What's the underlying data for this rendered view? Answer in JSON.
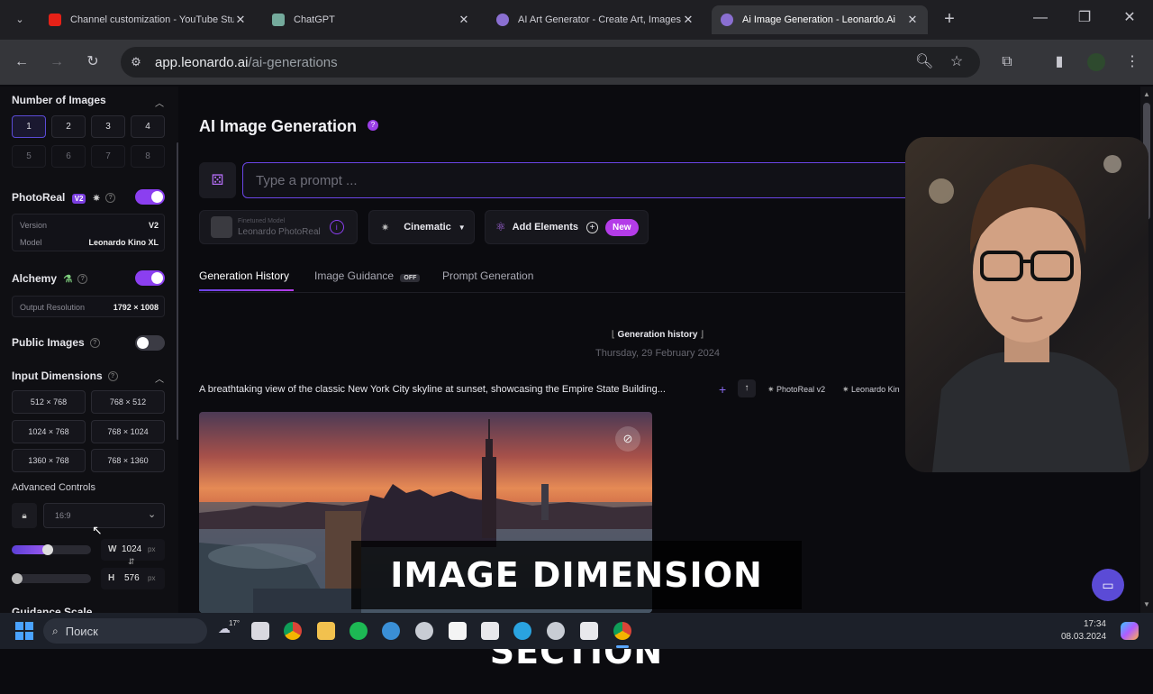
{
  "browser": {
    "tabs": [
      {
        "title": "Channel customization - YouTube Studi",
        "close": "✕"
      },
      {
        "title": "ChatGPT",
        "close": "✕"
      },
      {
        "title": "AI Art Generator - Create Art, Images &",
        "close": "✕"
      },
      {
        "title": "Ai Image Generation - Leonardo.Ai",
        "close": "✕"
      }
    ],
    "new_tab": "+",
    "url_host": "app.leonardo.ai",
    "url_path": "/ai-generations"
  },
  "sidebar": {
    "number_of_images": {
      "title": "Number of Images",
      "options": [
        "1",
        "2",
        "3",
        "4",
        "5",
        "6",
        "7",
        "8"
      ]
    },
    "photoreal": {
      "title": "PhotoReal",
      "badge": "V2",
      "version_label": "Version",
      "version_value": "V2",
      "model_label": "Model",
      "model_value": "Leonardo Kino XL"
    },
    "alchemy": {
      "title": "Alchemy",
      "output_label": "Output Resolution",
      "output_value": "1792 × 1008"
    },
    "public_images": {
      "title": "Public Images"
    },
    "input_dimensions": {
      "title": "Input Dimensions",
      "options": [
        "512 × 768",
        "768 × 512",
        "1024 × 768",
        "768 × 1024",
        "1360 × 768",
        "768 × 1360"
      ]
    },
    "advanced_controls": {
      "title": "Advanced Controls",
      "ratio": "16:9",
      "width_label": "W",
      "width_value": "1024",
      "height_label": "H",
      "height_value": "576",
      "unit": "px",
      "width_slider_fraction": 0.45,
      "height_slider_fraction": 0.0
    },
    "guidance_scale": {
      "title": "Guidance Scale"
    }
  },
  "main": {
    "title": "AI Image Generation",
    "prompt_placeholder": "Type a prompt ...",
    "finetuned_label": "Finetuned Model",
    "finetuned_value": "Leonardo PhotoReal",
    "style": "Cinematic",
    "add_elements": "Add Elements",
    "new_badge": "New",
    "tabs": [
      {
        "label": "Generation History",
        "active": true
      },
      {
        "label": "Image Guidance",
        "badge": "OFF"
      },
      {
        "label": "Prompt Generation"
      }
    ],
    "history_title": "Generation history",
    "history_date": "Thursday, 29 February 2024",
    "generation_prompt": "A breathtaking view of the classic New York City skyline at sunset, showcasing the Empire State Building...",
    "tag_model": "PhotoReal v2",
    "tag_kino": "Leonardo Kin"
  },
  "caption": "IMAGE DIMENSION SECTION",
  "taskbar": {
    "search_placeholder": "Поиск",
    "weather": "17°",
    "time": "17:34",
    "date": "08.03.2024"
  },
  "colors": {
    "accent": "#8b3ff0",
    "accent_blue": "#5b4bd6",
    "background": "#0b0b0f"
  }
}
